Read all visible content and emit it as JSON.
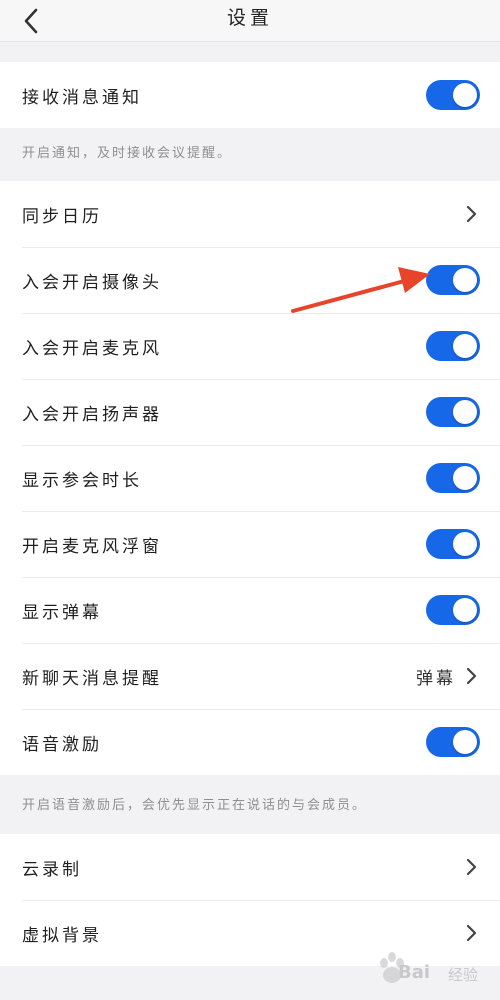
{
  "header": {
    "title": "设置"
  },
  "group1": {
    "items": [
      {
        "label": "接收消息通知",
        "control": "toggle",
        "on": true
      }
    ],
    "hint": "开启通知，及时接收会议提醒。"
  },
  "group2": {
    "items": [
      {
        "label": "同步日历",
        "control": "chevron"
      },
      {
        "label": "入会开启摄像头",
        "control": "toggle",
        "on": true
      },
      {
        "label": "入会开启麦克风",
        "control": "toggle",
        "on": true
      },
      {
        "label": "入会开启扬声器",
        "control": "toggle",
        "on": true
      },
      {
        "label": "显示参会时长",
        "control": "toggle",
        "on": true
      },
      {
        "label": "开启麦克风浮窗",
        "control": "toggle",
        "on": true
      },
      {
        "label": "显示弹幕",
        "control": "toggle",
        "on": true
      },
      {
        "label": "新聊天消息提醒",
        "control": "chevron",
        "value": "弹幕"
      },
      {
        "label": "语音激励",
        "control": "toggle",
        "on": true
      }
    ],
    "hint": "开启语音激励后，会优先显示正在说话的与会成员。"
  },
  "group3": {
    "items": [
      {
        "label": "云录制",
        "control": "chevron"
      },
      {
        "label": "虚拟背景",
        "control": "chevron"
      }
    ]
  },
  "watermark": {
    "brand": "Bai",
    "sub": "经验"
  },
  "colors": {
    "accent": "#1668e8",
    "arrow": "#e8432b",
    "background": "#f2f2f4"
  }
}
